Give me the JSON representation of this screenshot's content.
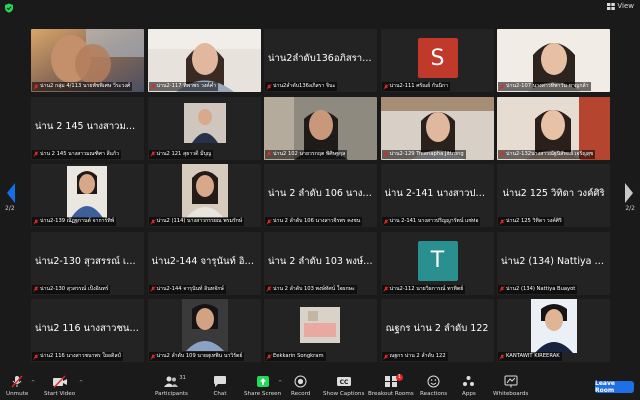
{
  "colors": {
    "background": "#1a1a1a",
    "tile": "#232323",
    "accent_blue": "#0e71eb",
    "leave_blue": "#1f6fe5",
    "share_green": "#23d959",
    "mic_red": "#e02828",
    "avatar_s": "#c0392b",
    "avatar_t": "#2a8f8f"
  },
  "header": {
    "view_label": "View",
    "security_icon": "shield-check-icon"
  },
  "pagination": {
    "left_label": "2/2",
    "right_label": "2/2"
  },
  "tiles": [
    {
      "label": "น่าน2 กลุ่ม 4/113 นายพัชพิเศษ วีระวงศ์",
      "center": "",
      "kind": "video"
    },
    {
      "label": "น่าน2-117 ทิพาพร วงค์คำ",
      "center": "",
      "kind": "video"
    },
    {
      "label": "น่าน2ลำดับ136อภิสรา จินะ",
      "center": "น่าน2ลำดับ136อภิสรา จินะ",
      "kind": "name"
    },
    {
      "label": "น่าน2-111 ศรัณย์ กันนิกา",
      "center": "S",
      "kind": "avatar"
    },
    {
      "label": "น่าน2-107 นางสาวทิพาวัน หาญกล้า",
      "center": "",
      "kind": "video"
    },
    {
      "label": "น่าน 2 145 นางสาวมณฑิศา สีแก้ว",
      "center": "น่าน 2 145 นางสาวมณ...",
      "kind": "name"
    },
    {
      "label": "น่าน2 121 สุธาวดี มีบุญ",
      "center": "",
      "kind": "video"
    },
    {
      "label": "น่าน2 102 นายวรกฤต พิศิษฐกุล",
      "center": "",
      "kind": "video"
    },
    {
      "label": "น่าน2-129 Treenapha Jittrong",
      "center": "",
      "kind": "video"
    },
    {
      "label": "น่าน2-132นางสาวณัฐนิสัทธย์ เจริญสุข",
      "center": "",
      "kind": "video"
    },
    {
      "label": "น่าน2-139 ณัฏฐกานต์ จาการ์ทิพ์",
      "center": "",
      "kind": "video"
    },
    {
      "label": "น่าน2 (114) นางสาวกรรยณ พรมรักษ์",
      "center": "",
      "kind": "video"
    },
    {
      "label": "น่าน 2 ลำดับ 106 นางสาวจิรพร คงชน",
      "center": "น่าน 2 ลำดับ 106 นางส...",
      "kind": "name"
    },
    {
      "label": "น่าน 2-141 นางสาวปริญญารัตน์ แซ่ห่อ",
      "center": "น่าน 2-141 นางสาวปริญ...",
      "kind": "name"
    },
    {
      "label": "น่าน2 125 วิทิดา วงค์ศิริ",
      "center": "น่าน2 125 วิทิดา วงค์ศิริ",
      "kind": "name"
    },
    {
      "label": "น่าน2-130 สุวสรรณ์ เป็งอินทร์",
      "center": "น่าน2-130 สุวสรรณ์ เป็งอิ...",
      "kind": "name"
    },
    {
      "label": "น่าน2-144 จารุนันท์ อินทจักษ์",
      "center": "น่าน2-144 จารุนันท์ อินท...",
      "kind": "name"
    },
    {
      "label": "น่าน 2 ลำดับ 103 พงษ์ทัศน์ ใจผกษะ",
      "center": "น่าน 2 ลำดับ 103 พงษ์ทั...",
      "kind": "name"
    },
    {
      "label": "น่าน2-112 นายวิธการณ์ ทาทิตย์",
      "center": "T",
      "kind": "avatar"
    },
    {
      "label": "น่าน2 (134) Nattiya Buayot",
      "center": "น่าน2 (134) Nattiya Buayot",
      "kind": "name"
    },
    {
      "label": "น่าน2 116 นางสาวชนาพร ใยอดิลป์",
      "center": "น่าน2 116 นางสาวชนาพร...",
      "kind": "name"
    },
    {
      "label": "น่าน2 ลำดับ 109 นายสุเทพิน นาวิรัตย์",
      "center": "",
      "kind": "video"
    },
    {
      "label": "Eekkarin Songkram",
      "center": "",
      "kind": "video"
    },
    {
      "label": "ณฐกร น่าน 2 ลำดับ 122",
      "center": "ณฐกร น่าน 2 ลำดับ 122",
      "kind": "name"
    },
    {
      "label": "KANTAWIT KIREERAK",
      "center": "",
      "kind": "video"
    }
  ],
  "toolbar": {
    "unmute": "Unmute",
    "start_video": "Start Video",
    "participants": "Participants",
    "participants_count": "31",
    "chat": "Chat",
    "share_screen": "Share Screen",
    "record": "Record",
    "show_captions": "Show Captions",
    "cc": "CC",
    "breakout_rooms": "Breakout Rooms",
    "breakout_badge": "1",
    "reactions": "Reactions",
    "apps": "Apps",
    "whiteboards": "Whiteboards",
    "leave_room": "Leave Room"
  }
}
